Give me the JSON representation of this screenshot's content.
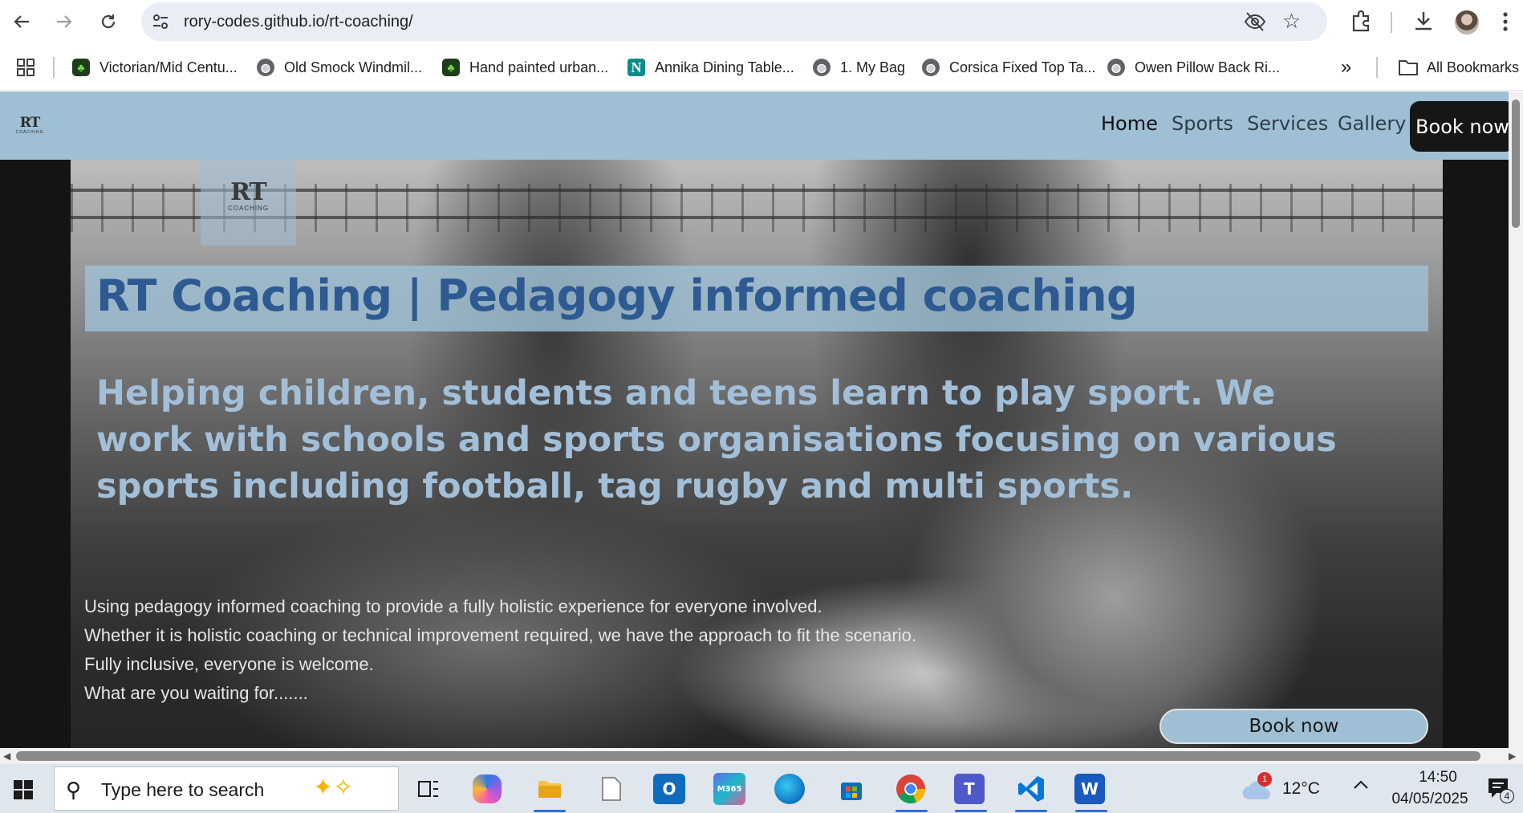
{
  "browser": {
    "url": "rory-codes.github.io/rt-coaching/",
    "bookmarks": [
      {
        "label": "Victorian/Mid Centu...",
        "icon": "leaf-favicon-icon"
      },
      {
        "label": "Old Smock Windmil...",
        "icon": "globe-icon"
      },
      {
        "label": "Hand painted urban...",
        "icon": "leaf-favicon-icon"
      },
      {
        "label": "Annika Dining Table...",
        "icon": "n-favicon-icon"
      },
      {
        "label": "1. My Bag",
        "icon": "globe-icon"
      },
      {
        "label": "Corsica Fixed Top Ta...",
        "icon": "globe-icon"
      },
      {
        "label": "Owen Pillow Back Ri...",
        "icon": "globe-icon"
      }
    ],
    "more_bookmarks_glyph": "»",
    "all_bookmarks_label": "All Bookmarks"
  },
  "site": {
    "logo_text": "RT",
    "logo_subtext": "COACHING",
    "nav": {
      "links": [
        {
          "label": "Home",
          "active": true
        },
        {
          "label": "Sports",
          "active": false
        },
        {
          "label": "Services",
          "active": false
        },
        {
          "label": "Gallery",
          "active": false
        }
      ],
      "book_label": "Book now"
    },
    "hero": {
      "title": "RT Coaching | Pedagogy informed coaching",
      "subtitle": "Helping children, students and teens learn to play sport. We work with schools and sports organisations focusing on various sports including football, tag rugby and multi sports.",
      "body_lines": [
        "Using pedagogy informed coaching to provide a fully holistic experience for everyone involved.",
        "Whether it is holistic coaching or technical improvement required, we have the approach to fit the scenario.",
        "Fully inclusive, everyone is welcome.",
        "What are you waiting for......."
      ],
      "book_label": "Book now"
    },
    "colors": {
      "nav_bg": "#9fbfd4",
      "title_color": "#2e5a92",
      "subtitle_color": "#a3bfd8",
      "book_button_dark": "#161616"
    }
  },
  "taskbar": {
    "search_placeholder": "Type here to search",
    "apps": [
      "copilot-icon",
      "file-explorer-icon",
      "blank-file-icon",
      "outlook-icon",
      "m365-icon",
      "edge-icon",
      "microsoft-store-icon",
      "chrome-icon",
      "teams-icon",
      "vscode-icon",
      "word-icon"
    ],
    "m365_label": "M365",
    "weather_badge": "1",
    "temperature": "12°C",
    "time": "14:50",
    "date": "04/05/2025",
    "notification_count": "4"
  }
}
